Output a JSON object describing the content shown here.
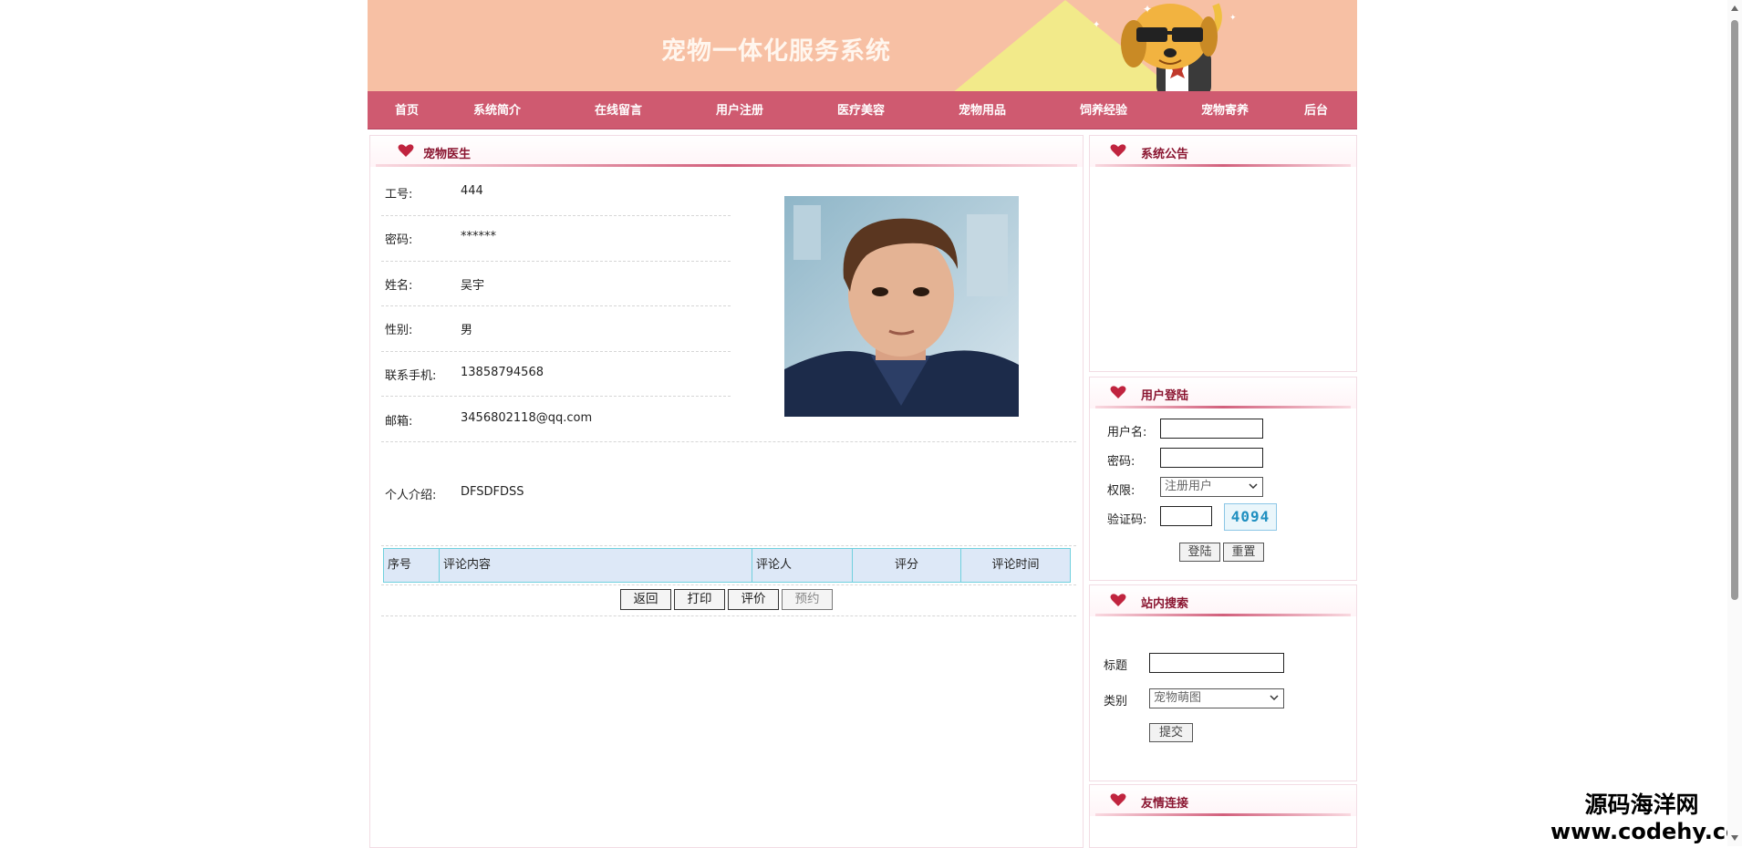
{
  "header": {
    "title": "宠物一体化服务系统"
  },
  "nav": {
    "items": [
      {
        "label": "首页"
      },
      {
        "label": "系统简介"
      },
      {
        "label": "在线留言"
      },
      {
        "label": "用户注册"
      },
      {
        "label": "医疗美容"
      },
      {
        "label": "宠物用品"
      },
      {
        "label": "饲养经验"
      },
      {
        "label": "宠物寄养"
      },
      {
        "label": "后台"
      }
    ]
  },
  "main": {
    "panel_title": "宠物医生",
    "fields": [
      {
        "label": "工号:",
        "value": "444"
      },
      {
        "label": "密码:",
        "value": "******"
      },
      {
        "label": "姓名:",
        "value": "吴宇"
      },
      {
        "label": "性别:",
        "value": "男"
      },
      {
        "label": "联系手机:",
        "value": "13858794568"
      },
      {
        "label": "邮箱:",
        "value": "3456802118@qq.com"
      }
    ],
    "intro": {
      "label": "个人介绍:",
      "value": "DFSDFDSS"
    },
    "table": {
      "headers": [
        "序号",
        "评论内容",
        "评论人",
        "评分",
        "评论时间"
      ]
    },
    "buttons": {
      "back": "返回",
      "print": "打印",
      "rate": "评价",
      "book": "预约"
    }
  },
  "sidebar": {
    "notice_title": "系统公告",
    "login": {
      "title": "用户登陆",
      "username_label": "用户名:",
      "password_label": "密码:",
      "role_label": "权限:",
      "role_value": "注册用户",
      "captcha_label": "验证码:",
      "captcha_code": "4094",
      "login_button": "登陆",
      "reset_button": "重置"
    },
    "search": {
      "title": "站内搜索",
      "title_label": "标题",
      "category_label": "类别",
      "category_value": "宠物萌图",
      "submit_button": "提交"
    },
    "links_title": "友情连接"
  },
  "watermark": {
    "line1": "源码海洋网",
    "line2": "www.codehy.com"
  },
  "colors": {
    "banner": "#f7c0a4",
    "nav": "#cf5a70",
    "panel_title": "#8a1530",
    "table_border": "#6fd0de",
    "table_bg": "#dde8f7"
  }
}
